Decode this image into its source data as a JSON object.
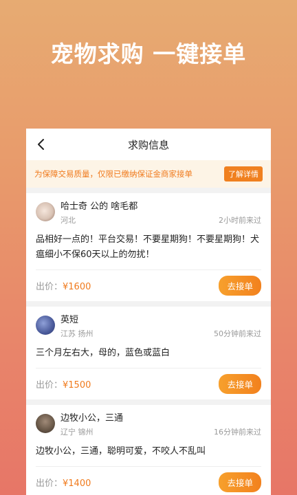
{
  "hero_title": "宠物求购 一键接单",
  "nav": {
    "title": "求购信息"
  },
  "notice": {
    "text": "为保障交易质量，仅限已缴纳保证金商家接单",
    "button": "了解详情"
  },
  "price_label": "出价：",
  "action_label": "去接单",
  "cards": [
    {
      "name": "哈士奇 公的 啥毛都",
      "location": "河北",
      "time": "2小时前来过",
      "description": "品相好一点的！平台交易！不要星期狗！不要星期狗！犬瘟细小不保60天以上的勿扰！",
      "price": "¥1600",
      "avatar_color": "#d9c3b5"
    },
    {
      "name": "英短",
      "location": "江苏 扬州",
      "time": "50分钟前来过",
      "description": "三个月左右大，母的，蓝色或蓝白",
      "price": "¥1500",
      "avatar_color": "#4a5a9a"
    },
    {
      "name": "边牧小公，三通",
      "location": "辽宁 锦州",
      "time": "16分钟前来过",
      "description": "边牧小公，三通，聪明可爱，不咬人不乱叫",
      "price": "¥1400",
      "avatar_color": "#6b5a4a"
    }
  ]
}
